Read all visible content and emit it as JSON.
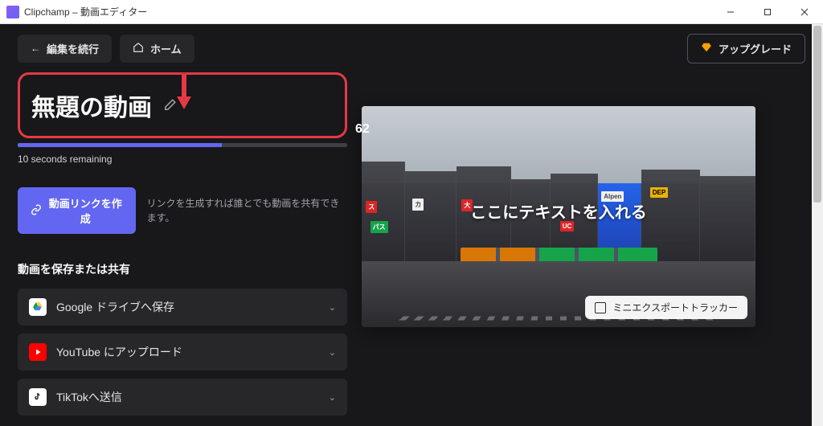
{
  "titlebar": {
    "app_name": "Clipchamp – 動画エディター"
  },
  "topnav": {
    "continue_edit": "編集を続行",
    "home": "ホーム",
    "upgrade": "アップグレード"
  },
  "export": {
    "video_title": "無題の動画",
    "progress_percent": 62,
    "progress_percent_text": "62",
    "remaining_text": "10 seconds remaining",
    "create_link_label": "動画リンクを作成",
    "create_link_desc": "リンクを生成すれば誰とでも動画を共有できます。",
    "save_share_title": "動画を保存または共有",
    "share_items": [
      {
        "label": "Google ドライブへ保存"
      },
      {
        "label": "YouTube にアップロード"
      },
      {
        "label": "TikTokへ送信"
      }
    ]
  },
  "preview": {
    "overlay_text": "ここにテキストを入れる",
    "mini_tracker": "ミニエクスポートトラッカー",
    "signs": {
      "alpen": "Alpen",
      "dep": "DEP"
    }
  },
  "colors": {
    "accent": "#6366f1",
    "annotation": "#e63946",
    "upgrade_diamond": "#f59e0b",
    "bg_dark": "#18181b",
    "panel": "#27272a"
  }
}
